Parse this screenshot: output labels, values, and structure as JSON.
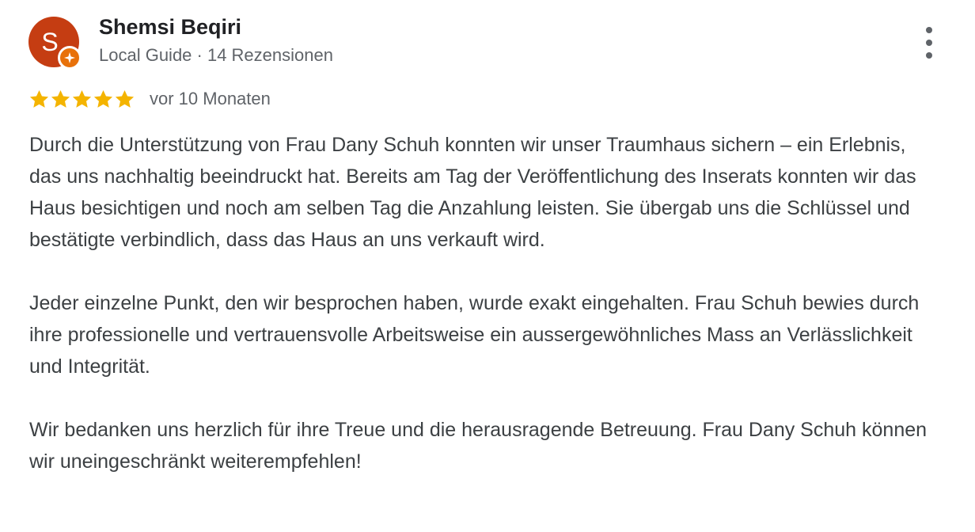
{
  "reviewer": {
    "avatar_letter": "S",
    "name": "Shemsi Beqiri",
    "meta": "Local Guide · 14 Rezensionen"
  },
  "icons": {
    "badge": "local-guide-badge-icon",
    "menu": "more-vertical-icon",
    "star": "star-icon"
  },
  "rating": {
    "stars": 5,
    "max": 5,
    "date": "vor 10 Monaten"
  },
  "review": {
    "paragraphs": [
      "Durch die Unterstützung von Frau Dany Schuh konnten wir unser Traumhaus sichern – ein Erlebnis, das uns nachhaltig beeindruckt hat. Bereits am Tag der Veröffentlichung des Inserats konnten wir das Haus besichtigen und noch am selben Tag die Anzahlung leisten. Sie übergab uns die Schlüssel und bestätigte verbindlich, dass das Haus an uns verkauft wird.",
      "Jeder einzelne Punkt, den wir besprochen haben, wurde exakt eingehalten. Frau Schuh bewies durch ihre professionelle und vertrauensvolle Arbeitsweise ein aussergewöhnliches Mass an Verlässlichkeit und Integrität.",
      "Wir bedanken uns herzlich für ihre Treue und die herausragende Betreuung. Frau Dany Schuh können wir uneingeschränkt weiterempfehlen!"
    ]
  },
  "colors": {
    "avatar_bg": "#c53d12",
    "badge_bg": "#e8710a",
    "star": "#f4b400",
    "name": "#202124",
    "secondary_text": "#5f6368",
    "body_text": "#3c4043"
  }
}
